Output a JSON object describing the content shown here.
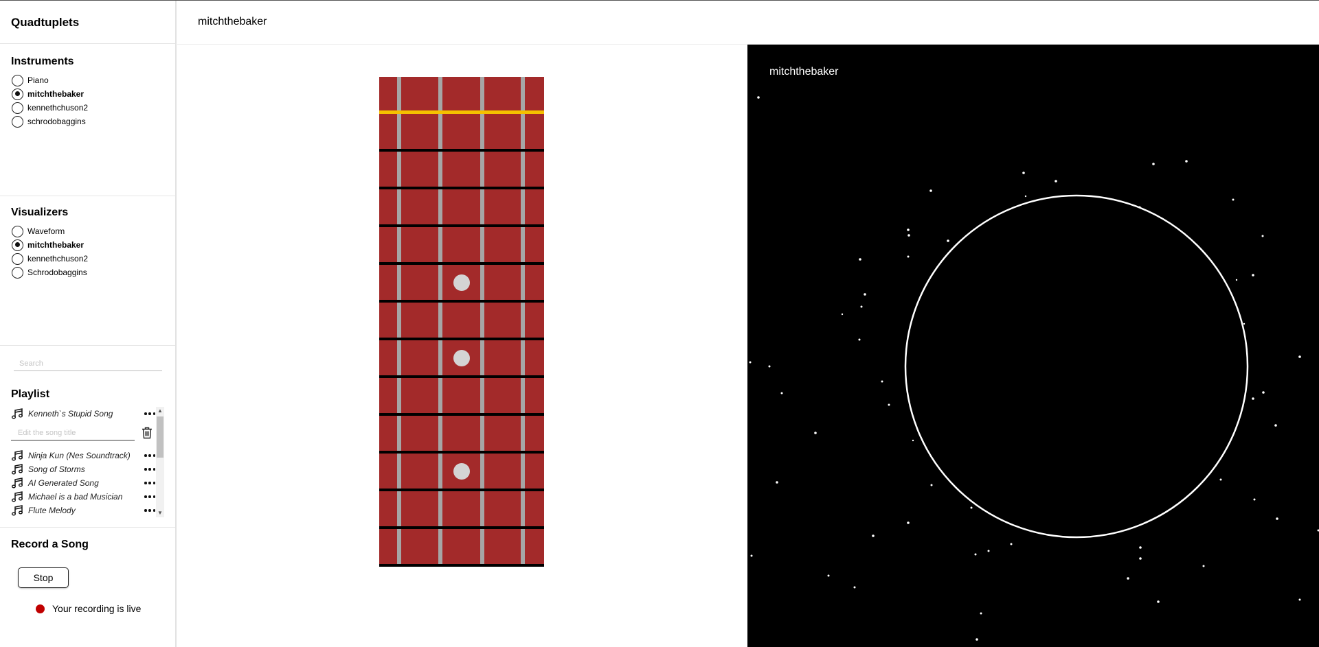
{
  "app_title": "Quadtuplets",
  "header": {
    "title": "mitchthebaker"
  },
  "instruments": {
    "title": "Instruments",
    "items": [
      {
        "label": "Piano",
        "selected": false
      },
      {
        "label": "mitchthebaker",
        "selected": true
      },
      {
        "label": "kennethchuson2",
        "selected": false
      },
      {
        "label": "schrodobaggins",
        "selected": false
      }
    ]
  },
  "visualizers": {
    "title": "Visualizers",
    "items": [
      {
        "label": "Waveform",
        "selected": false
      },
      {
        "label": "mitchthebaker",
        "selected": true
      },
      {
        "label": "kennethchuson2",
        "selected": false
      },
      {
        "label": "Schrodobaggins",
        "selected": false
      }
    ]
  },
  "search": {
    "placeholder": "Search"
  },
  "playlist": {
    "title": "Playlist",
    "edit_placeholder": "Edit the song title",
    "songs": [
      "Kenneth`s Stupid Song",
      "Ninja Kun (Nes Soundtrack)",
      "Song of Storms",
      "AI Generated Song",
      "Michael is a bad Musician",
      "Flute Melody"
    ]
  },
  "record": {
    "title": "Record a Song",
    "stop_label": "Stop",
    "status": "Your recording is live",
    "live_color": "#c00000"
  },
  "fretboard": {
    "background_color": "#a32a2a",
    "nut_color": "#f5c000",
    "string_count": 4,
    "fret_count": 12,
    "marker_frets": [
      5,
      7,
      10
    ]
  },
  "visualizer": {
    "label": "mitchthebaker",
    "background_color": "#000000",
    "ring_color": "#ffffff"
  },
  "icons": {
    "song": "music-note-icon",
    "more": "more-dots-icon",
    "delete": "trash-icon"
  }
}
